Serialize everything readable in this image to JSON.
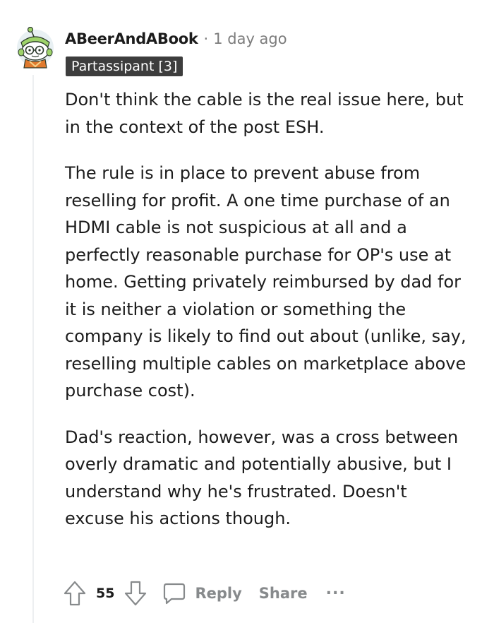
{
  "comment": {
    "username": "ABeerAndABook",
    "separator": "·",
    "timestamp": "1 day ago",
    "flair": "Partassipant [3]",
    "paragraphs": [
      "Don't think the cable is the real issue here, but in the context of the post ESH.",
      "The rule is in place to prevent abuse from reselling for profit. A one time purchase of an HDMI cable is not suspicious at all and a perfectly reasonable purchase for OP's use at home. Getting privately reimbursed by dad for it is neither a violation or something the company is likely to find out about (unlike, say, reselling multiple cables on marketplace above purchase cost).",
      "Dad's reaction, however, was a cross between overly dramatic and potentially abusive, but I understand why he's frustrated. Doesn't excuse his actions though."
    ]
  },
  "actions": {
    "upvote_icon": "upvote-arrow-icon",
    "score": "55",
    "downvote_icon": "downvote-arrow-icon",
    "reply_icon": "comment-bubble-icon",
    "reply_label": "Reply",
    "share_label": "Share",
    "more_label": "..."
  },
  "colors": {
    "text": "#1c1c1c",
    "muted": "#7c7c7c",
    "action_gray": "#878a8c",
    "flair_bg": "#3d3d3d",
    "flair_text": "#ffffff",
    "thread_line": "#edeff1",
    "avatar_green": "#9ed36a"
  }
}
